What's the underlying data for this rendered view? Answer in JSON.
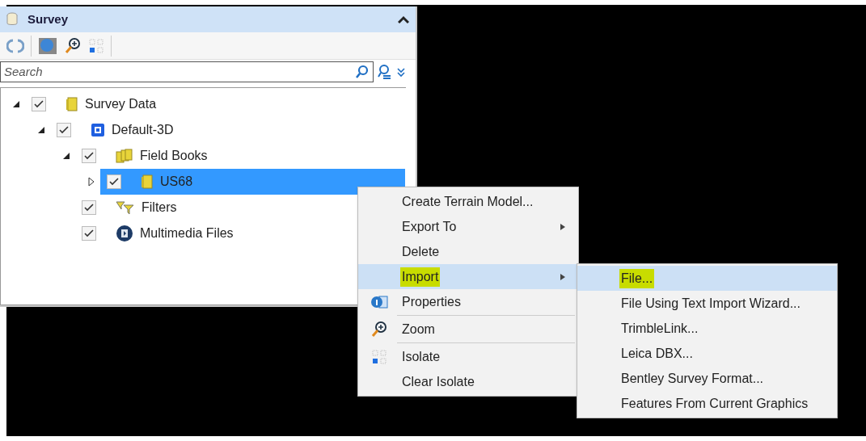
{
  "panel": {
    "title": "Survey",
    "collapsed": false
  },
  "toolbar": [
    {
      "kind": "refresh"
    },
    {
      "kind": "sphere"
    },
    {
      "kind": "zoom"
    },
    {
      "kind": "isolate"
    }
  ],
  "search": {
    "placeholder": "Search"
  },
  "tree": [
    {
      "label": "Survey Data",
      "kind": "folder",
      "checked": true,
      "expanded": true,
      "selected": false,
      "children": [
        {
          "label": "Default-3D",
          "kind": "model",
          "checked": true,
          "expanded": true,
          "selected": false,
          "children": [
            {
              "label": "Field Books",
              "kind": "books",
              "checked": true,
              "expanded": true,
              "selected": false,
              "children": [
                {
                  "label": "US68",
                  "kind": "folder",
                  "checked": true,
                  "expanded": false,
                  "has_children": true,
                  "selected": true
                }
              ]
            },
            {
              "label": "Filters",
              "kind": "filter",
              "checked": true,
              "selected": false
            },
            {
              "label": "Multimedia Files",
              "kind": "media",
              "checked": true,
              "selected": false
            }
          ]
        }
      ]
    }
  ],
  "context_menu": [
    {
      "label": "Create Terrain Model...",
      "selected": false
    },
    {
      "label": "Export To",
      "submenu": true,
      "selected": false
    },
    {
      "label": "Delete",
      "selected": false
    },
    {
      "label": "Import",
      "submenu": true,
      "selected": true,
      "marked": true
    },
    {
      "label": "Properties",
      "kind": "properties",
      "selected": false,
      "divider_after": true
    },
    {
      "label": "Zoom",
      "kind": "zoom",
      "selected": false,
      "divider_after": true
    },
    {
      "label": "Isolate",
      "kind": "isolate",
      "selected": false
    },
    {
      "label": "Clear Isolate",
      "selected": false
    }
  ],
  "submenu": [
    {
      "label": "File...",
      "selected": true,
      "marked": true
    },
    {
      "label": "File Using Text Import Wizard...",
      "selected": false
    },
    {
      "label": "TrimbleLink...",
      "selected": false
    },
    {
      "label": "Leica DBX...",
      "selected": false
    },
    {
      "label": "Bentley Survey Format...",
      "selected": false
    },
    {
      "label": "Features From Current Graphics",
      "selected": false
    }
  ]
}
